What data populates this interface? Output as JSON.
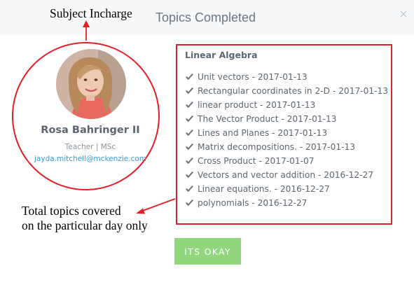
{
  "modal": {
    "title": "Topics Completed",
    "close_label": "×"
  },
  "annotations": {
    "subject_incharge": "Subject Incharge",
    "total_topics_line1": "Total topics covered",
    "total_topics_line2": "on the particular day only",
    "highlight_color": "#e41e26"
  },
  "teacher": {
    "name": "Rosa Bahringer II",
    "role": "Teacher | MSc",
    "email": "jayda.mitchell@mckenzie.com"
  },
  "topics": {
    "subject": "Linear Algebra",
    "items": [
      {
        "label": "Unit vectors - 2017-01-13"
      },
      {
        "label": "Rectangular coordinates in 2-D - 2017-01-13"
      },
      {
        "label": "linear product - 2017-01-13"
      },
      {
        "label": "The Vector Product - 2017-01-13"
      },
      {
        "label": "Lines and Planes - 2017-01-13"
      },
      {
        "label": "Matrix decompositions. - 2017-01-13"
      },
      {
        "label": "Cross Product - 2017-01-07"
      },
      {
        "label": "Vectors and vector addition - 2016-12-27"
      },
      {
        "label": "Linear equations. - 2016-12-27"
      },
      {
        "label": "polynomials - 2016-12-27"
      }
    ],
    "item_icon": "check-icon"
  },
  "footer": {
    "ok_label": "ITS OKAY",
    "ok_color": "#8fd67d"
  }
}
